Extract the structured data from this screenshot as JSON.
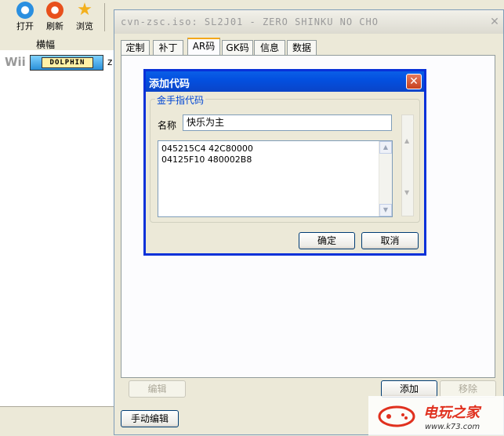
{
  "main_toolbar": {
    "buttons": [
      {
        "label": "打开",
        "icon": "open-icon",
        "color": "#2a8fe0"
      },
      {
        "label": "刷新",
        "icon": "refresh-icon",
        "color": "#e8501c"
      },
      {
        "label": "浏览",
        "icon": "star-icon",
        "color": "#f3b01c"
      }
    ]
  },
  "game_list": {
    "column_header": "横幅",
    "platform_label": "Wii",
    "banner_text": "DOLPHIN",
    "second_col_char": "z"
  },
  "properties_window": {
    "title": "cvn-zsc.iso: SL2J01 - ZERO SHINKU NO CHO",
    "tabs": [
      "定制",
      "补丁",
      "AR码",
      "GK码",
      "信息",
      "数据"
    ],
    "active_tab": "AR码",
    "buttons": {
      "edit": "编辑",
      "add": "添加",
      "remove": "移除",
      "manual_edit": "手动编辑"
    }
  },
  "add_code_dialog": {
    "title": "添加代码",
    "group_label": "金手指代码",
    "name_label": "名称",
    "name_value": "快乐为主",
    "code_lines": "045215C4 42C80000\n04125F10 480002B8",
    "ok": "确定",
    "cancel": "取消"
  },
  "watermark": {
    "title": "电玩之家",
    "url": "www.k73.com"
  }
}
